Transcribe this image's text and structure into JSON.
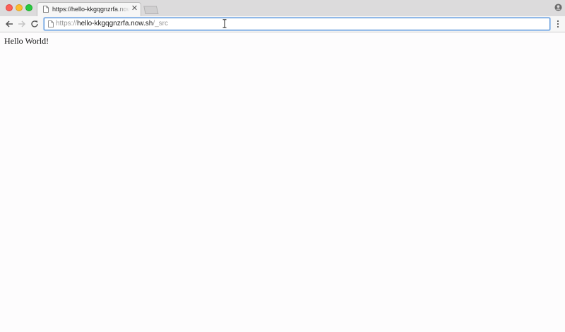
{
  "window": {
    "tab": {
      "title": "https://hello-kkgqgnzrfa.now.sh/_src",
      "close_glyph": "✕"
    }
  },
  "toolbar": {
    "address": {
      "scheme": "https://",
      "host": "hello-kkgqgnzrfa.now.sh",
      "path": "/_src"
    }
  },
  "page": {
    "body_text": "Hello World!"
  },
  "icons": {
    "back": "arrow-left-icon",
    "forward": "arrow-right-icon",
    "reload": "reload-icon",
    "page": "document-icon",
    "profile": "user-profile-icon",
    "menu": "more-vert-icon"
  },
  "colors": {
    "close": "#fc5f57",
    "minimize": "#fdbc2e",
    "maximize": "#28c840",
    "focus_ring": "#5f98d9"
  }
}
